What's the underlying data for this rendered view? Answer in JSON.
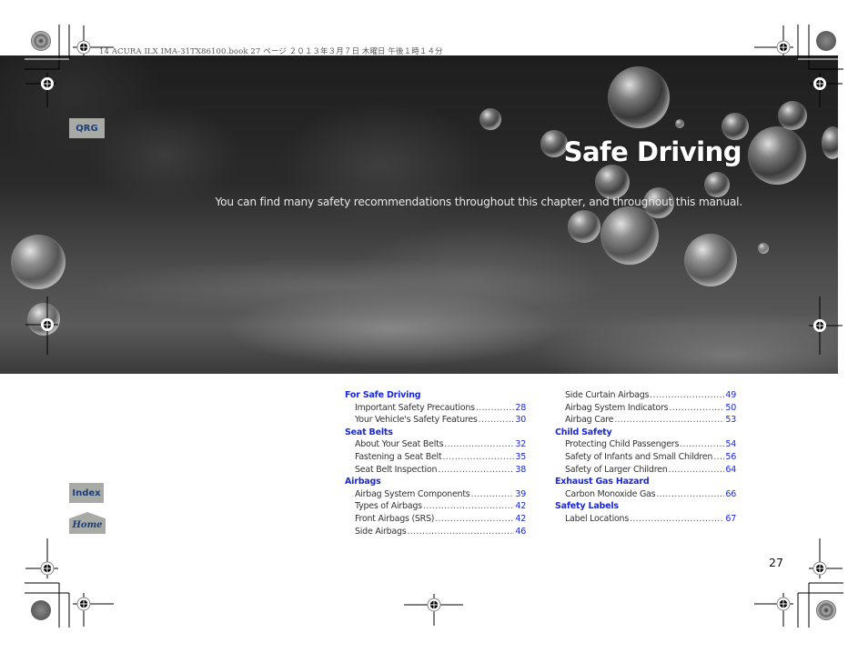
{
  "print_header": "14 ACURA ILX IMA-31TX86100.book  27 ページ  ２０１３年３月７日  木曜日  午後１時１４分",
  "hero": {
    "title": "Safe Driving",
    "subtitle": "You can find many safety recommendations throughout this chapter, and throughout this manual."
  },
  "nav_tabs": {
    "qrg": "QRG",
    "index": "Index",
    "home": "Home"
  },
  "toc": {
    "columns": [
      [
        {
          "type": "heading",
          "label": "For Safe Driving"
        },
        {
          "type": "item",
          "label": "Important Safety Precautions",
          "page": "28"
        },
        {
          "type": "item",
          "label": "Your Vehicle's Safety Features",
          "page": "30"
        },
        {
          "type": "heading",
          "label": "Seat Belts"
        },
        {
          "type": "item",
          "label": "About Your Seat Belts",
          "page": "32"
        },
        {
          "type": "item",
          "label": "Fastening a Seat Belt",
          "page": "35"
        },
        {
          "type": "item",
          "label": "Seat Belt Inspection",
          "page": "38"
        },
        {
          "type": "heading",
          "label": "Airbags"
        },
        {
          "type": "item",
          "label": "Airbag System Components",
          "page": "39"
        },
        {
          "type": "item",
          "label": "Types of Airbags",
          "page": "42"
        },
        {
          "type": "item",
          "label": "Front Airbags (SRS)",
          "page": "42"
        },
        {
          "type": "item",
          "label": "Side Airbags",
          "page": "46"
        }
      ],
      [
        {
          "type": "item",
          "label": "Side Curtain Airbags",
          "page": "49"
        },
        {
          "type": "item",
          "label": "Airbag System Indicators",
          "page": "50"
        },
        {
          "type": "item",
          "label": "Airbag Care",
          "page": "53"
        },
        {
          "type": "heading",
          "label": "Child Safety"
        },
        {
          "type": "item",
          "label": "Protecting Child Passengers",
          "page": "54"
        },
        {
          "type": "item",
          "label": "Safety of Infants and Small Children",
          "page": "56"
        },
        {
          "type": "item",
          "label": "Safety of Larger Children",
          "page": "64"
        },
        {
          "type": "heading",
          "label": "Exhaust Gas Hazard"
        },
        {
          "type": "item",
          "label": "Carbon Monoxide Gas",
          "page": "66"
        },
        {
          "type": "heading",
          "label": "Safety Labels"
        },
        {
          "type": "item",
          "label": "Label Locations",
          "page": "67"
        }
      ]
    ]
  },
  "page_number": "27",
  "colors": {
    "link_blue": "#1a28d8",
    "tab_gray": "#a8aaa6",
    "tab_text": "#1c3e78"
  }
}
